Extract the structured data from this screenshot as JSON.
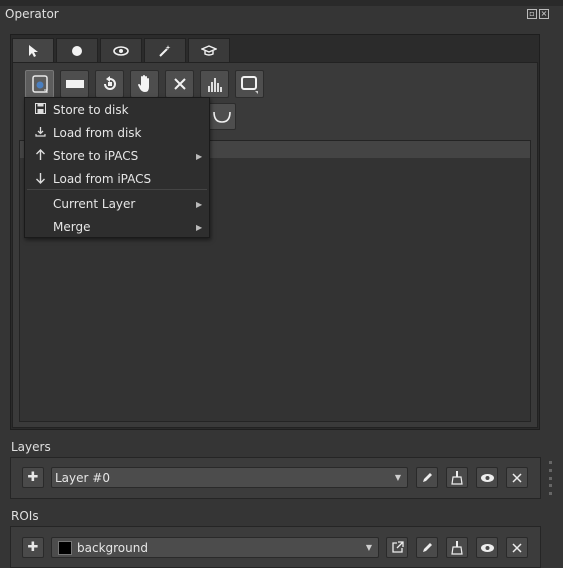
{
  "panel": {
    "title": "Operator"
  },
  "tabs": [
    {
      "name": "cursor-icon"
    },
    {
      "name": "dot-icon"
    },
    {
      "name": "eye-icon"
    },
    {
      "name": "magic-wand-icon"
    },
    {
      "name": "graduation-cap-icon"
    }
  ],
  "toolbar": [
    {
      "name": "layer-io-icon"
    },
    {
      "name": "rectangle-icon"
    },
    {
      "name": "reset-icon"
    },
    {
      "name": "hand-icon"
    },
    {
      "name": "close-icon"
    },
    {
      "name": "histogram-icon"
    },
    {
      "name": "square-icon"
    }
  ],
  "menu": {
    "items": [
      {
        "label": "Store to disk",
        "icon": "save-icon"
      },
      {
        "label": "Load from disk",
        "icon": "download-icon"
      },
      {
        "label": "Store to iPACS",
        "icon": "arrow-up-icon",
        "submenu": true
      },
      {
        "label": "Load from iPACS",
        "icon": "arrow-down-icon"
      },
      {
        "label": "Current Layer",
        "submenu": true
      },
      {
        "label": "Merge",
        "submenu": true
      }
    ]
  },
  "layers": {
    "label": "Layers",
    "selected": "Layer #0"
  },
  "rois": {
    "label": "ROIs",
    "selected": "background",
    "swatch_color": "#000000"
  }
}
